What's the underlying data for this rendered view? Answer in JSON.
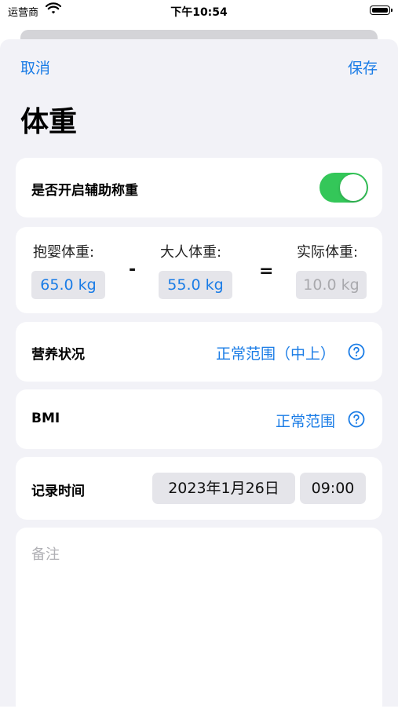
{
  "status_bar": {
    "carrier": "运营商",
    "time": "下午10:54"
  },
  "nav": {
    "cancel": "取消",
    "save": "保存"
  },
  "page_title": "体重",
  "assist": {
    "label": "是否开启辅助称重",
    "enabled": true
  },
  "weights": {
    "hold_label": "抱婴体重:",
    "hold_value": "65.0 kg",
    "minus": "-",
    "adult_label": "大人体重:",
    "adult_value": "55.0 kg",
    "equals": "=",
    "actual_label": "实际体重:",
    "actual_value": "10.0 kg"
  },
  "nutrition": {
    "label": "营养状况",
    "value": "正常范围（中上）"
  },
  "bmi": {
    "label": "BMI",
    "value": "正常范围"
  },
  "record": {
    "label": "记录时间",
    "date": "2023年1月26日",
    "time": "09:00"
  },
  "notes": {
    "placeholder": "备注"
  },
  "colors": {
    "accent": "#1a7ce6",
    "toggle_on": "#34c759",
    "background": "#f2f2f7"
  }
}
